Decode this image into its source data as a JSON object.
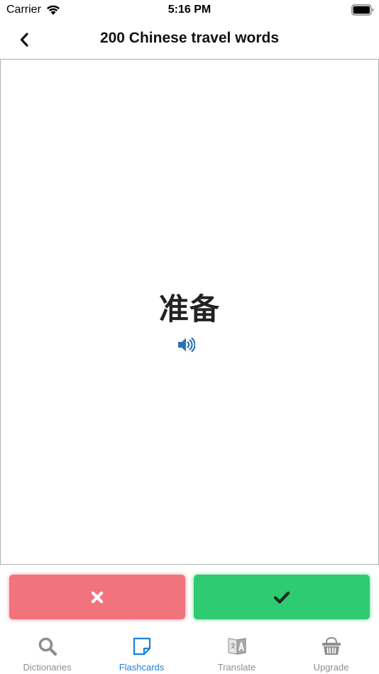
{
  "status_bar": {
    "carrier": "Carrier",
    "time": "5:16 PM"
  },
  "nav": {
    "title": "200 Chinese travel words",
    "back_icon": "chevron-left-icon"
  },
  "card": {
    "word": "准备",
    "speaker_icon": "speaker-icon"
  },
  "buttons": {
    "wrong_icon": "x-icon",
    "right_icon": "checkmark-icon",
    "wrong_color": "#f1737b",
    "right_color": "#2fcb72"
  },
  "tabs": [
    {
      "label": "Dictionaries",
      "icon": "search-icon",
      "active": false
    },
    {
      "label": "Flashcards",
      "icon": "flashcard-icon",
      "active": true
    },
    {
      "label": "Translate",
      "icon": "translate-icon",
      "active": false
    },
    {
      "label": "Upgrade",
      "icon": "basket-icon",
      "active": false
    }
  ],
  "colors": {
    "accent": "#1f7fd6",
    "inactive_tab": "#8e8e8e"
  }
}
